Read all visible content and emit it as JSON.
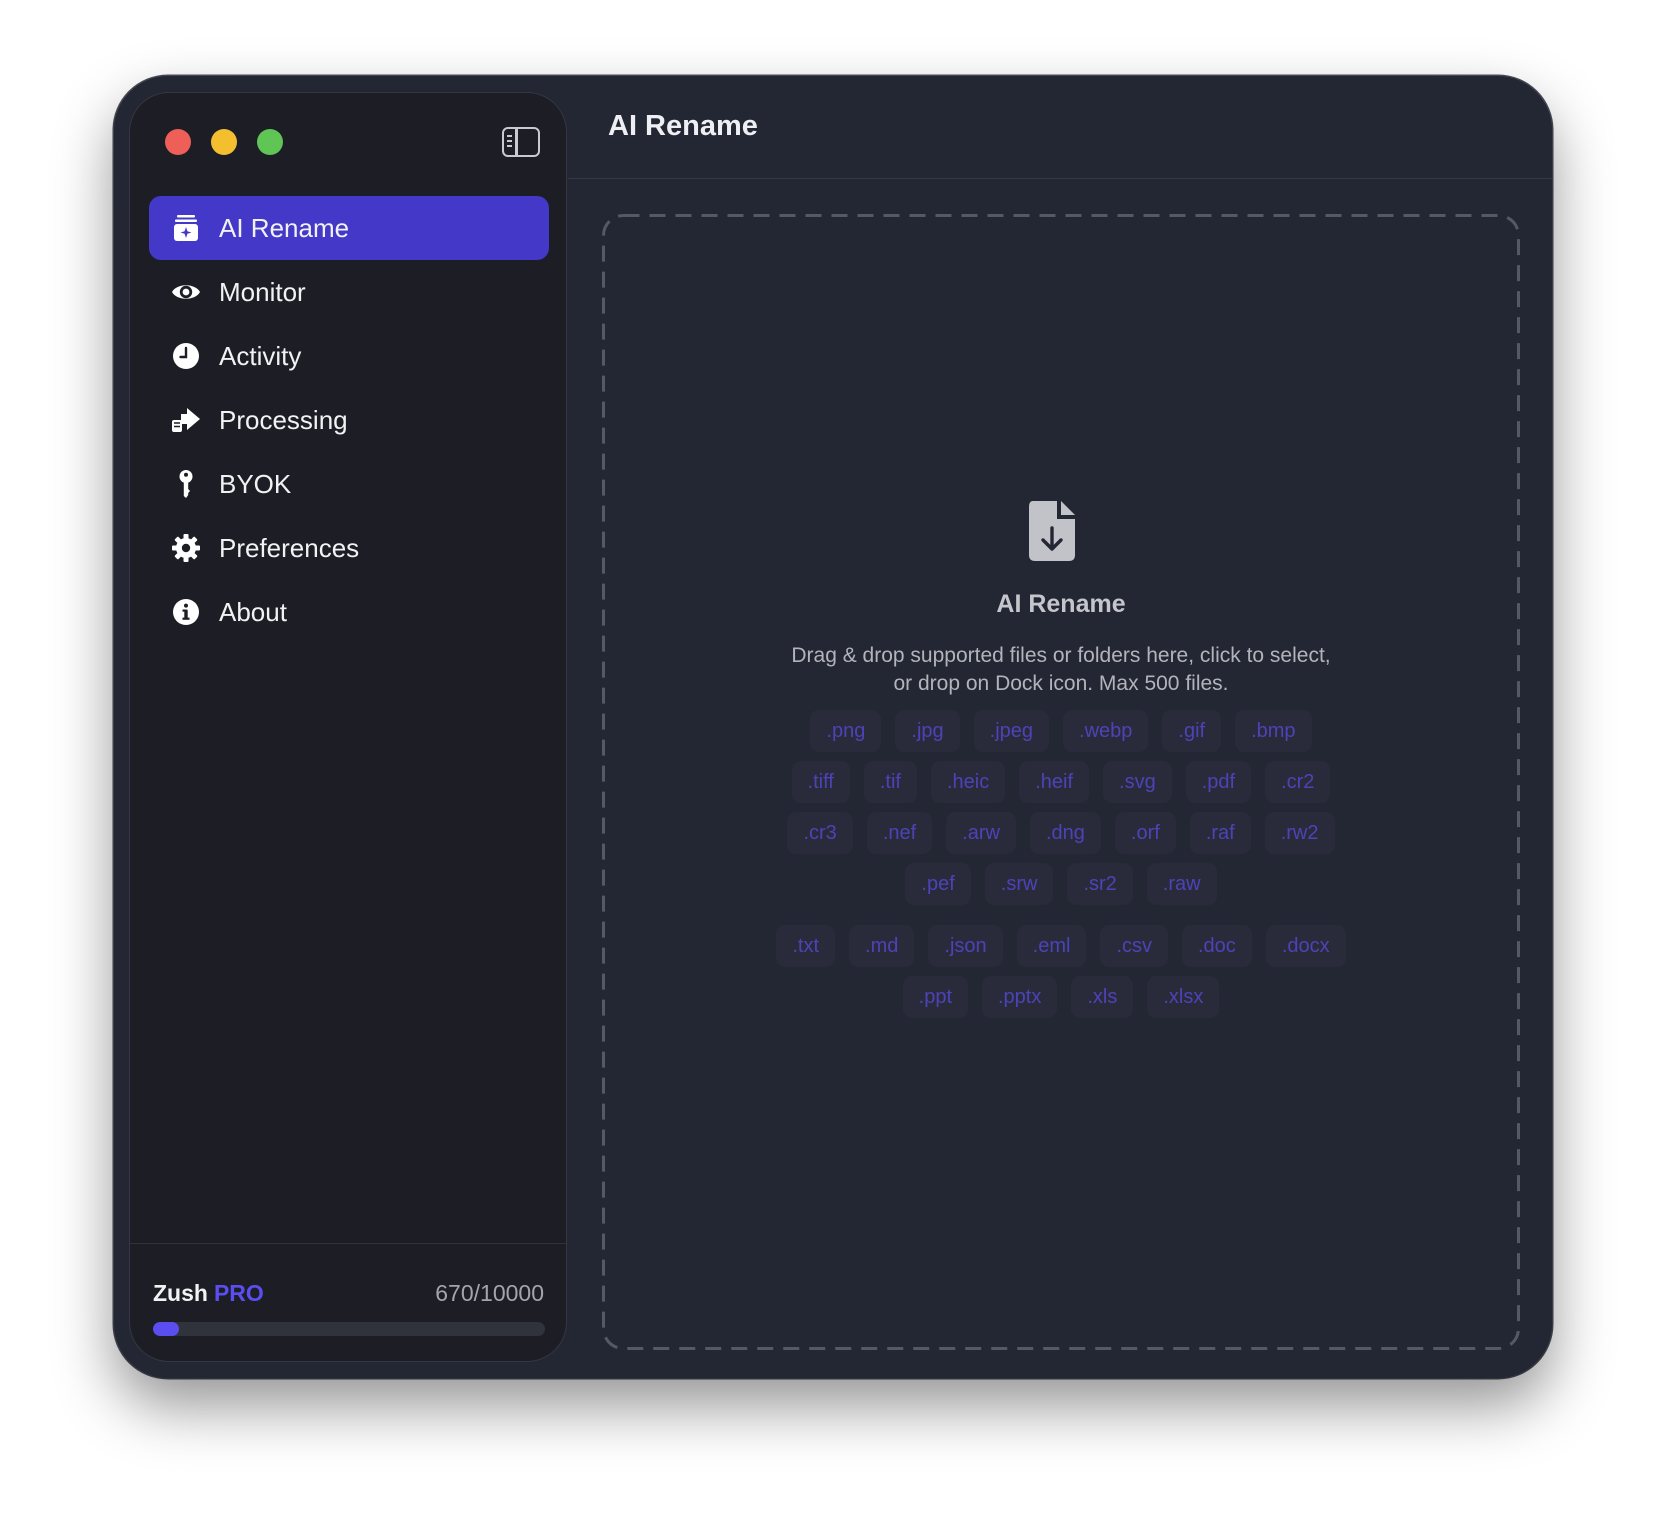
{
  "window": {
    "title": "AI Rename"
  },
  "sidebar": {
    "items": [
      {
        "label": "AI Rename",
        "icon": "ai-rename-icon",
        "active": true
      },
      {
        "label": "Monitor",
        "icon": "eye-icon",
        "active": false
      },
      {
        "label": "Activity",
        "icon": "clock-icon",
        "active": false
      },
      {
        "label": "Processing",
        "icon": "processing-icon",
        "active": false
      },
      {
        "label": "BYOK",
        "icon": "key-icon",
        "active": false
      },
      {
        "label": "Preferences",
        "icon": "gear-icon",
        "active": false
      },
      {
        "label": "About",
        "icon": "info-icon",
        "active": false
      }
    ],
    "plan": {
      "name": "Zush",
      "tier": "PRO",
      "usage_text": "670/10000",
      "used": 670,
      "limit": 10000
    }
  },
  "dropzone": {
    "icon": "file-download-icon",
    "title": "AI Rename",
    "description_line1": "Drag & drop supported files or folders here, click to select,",
    "description_line2": "or drop on Dock icon. Max 500 files.",
    "image_rows": [
      [
        ".png",
        ".jpg",
        ".jpeg",
        ".webp",
        ".gif",
        ".bmp"
      ],
      [
        ".tiff",
        ".tif",
        ".heic",
        ".heif",
        ".svg",
        ".pdf",
        ".cr2"
      ],
      [
        ".cr3",
        ".nef",
        ".arw",
        ".dng",
        ".orf",
        ".raf",
        ".rw2"
      ],
      [
        ".pef",
        ".srw",
        ".sr2",
        ".raw"
      ]
    ],
    "document_rows": [
      [
        ".txt",
        ".md",
        ".json",
        ".eml",
        ".csv",
        ".doc",
        ".docx"
      ],
      [
        ".ppt",
        ".pptx",
        ".xls",
        ".xlsx"
      ]
    ]
  },
  "colors": {
    "accent": "#4338c8",
    "pro": "#5b4ef0",
    "chip_text": "#4d43b8",
    "window_bg": "#232633",
    "sidebar_bg": "#1d1e25"
  }
}
